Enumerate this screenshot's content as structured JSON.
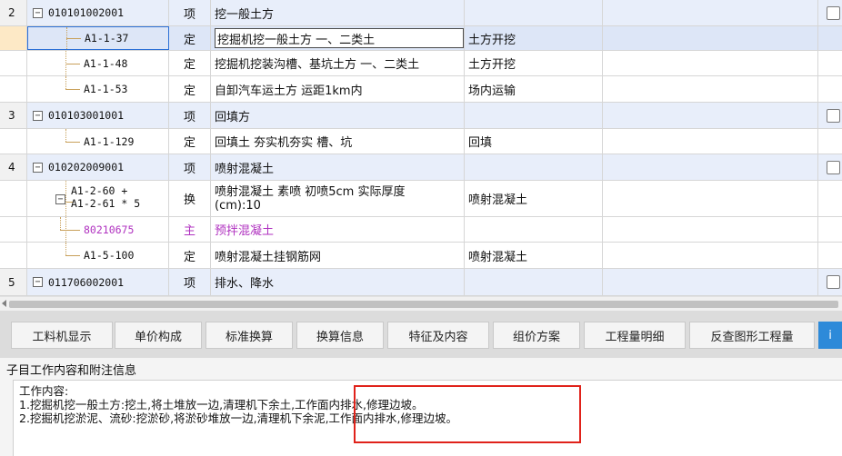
{
  "grid": {
    "rows": [
      {
        "kind": "item",
        "idx": "2",
        "code": "010101002001",
        "type": "项",
        "name": "挖一般土方",
        "spec": ""
      },
      {
        "kind": "sub",
        "idx": "",
        "code": "A1-1-37",
        "type": "定",
        "name": "挖掘机挖一般土方 一、二类土",
        "spec": "土方开挖",
        "selected": true
      },
      {
        "kind": "sub",
        "idx": "",
        "code": "A1-1-48",
        "type": "定",
        "name": "挖掘机挖装沟槽、基坑土方 一、二类土",
        "spec": "土方开挖"
      },
      {
        "kind": "sub",
        "idx": "",
        "code": "A1-1-53",
        "type": "定",
        "name": "自卸汽车运土方 运距1km内",
        "spec": "场内运输"
      },
      {
        "kind": "item",
        "idx": "3",
        "code": "010103001001",
        "type": "项",
        "name": "回填方",
        "spec": ""
      },
      {
        "kind": "sub",
        "idx": "",
        "code": "A1-1-129",
        "type": "定",
        "name": "回填土 夯实机夯实 槽、坑",
        "spec": "回填"
      },
      {
        "kind": "item",
        "idx": "4",
        "code": "010202009001",
        "type": "项",
        "name": "喷射混凝土",
        "spec": ""
      },
      {
        "kind": "sub2",
        "idx": "",
        "code_line1": "A1-2-60 +",
        "code_line2": "A1-2-61 * 5",
        "type": "换",
        "name_line1": "喷射混凝土 素喷 初喷5cm  实际厚度",
        "name_line2": "(cm):10",
        "spec": "喷射混凝土"
      },
      {
        "kind": "main",
        "idx": "",
        "code": "80210675",
        "type": "主",
        "name": "预拌混凝土",
        "spec": ""
      },
      {
        "kind": "sub",
        "idx": "",
        "code": "A1-5-100",
        "type": "定",
        "name": "喷射混凝土挂钢筋网",
        "spec": "喷射混凝土"
      },
      {
        "kind": "item",
        "idx": "5",
        "code": "011706002001",
        "type": "项",
        "name": "排水、降水",
        "spec": ""
      }
    ]
  },
  "tabs": [
    {
      "label": "工料机显示"
    },
    {
      "label": "单价构成"
    },
    {
      "label": "标准换算"
    },
    {
      "label": "换算信息"
    },
    {
      "label": "特征及内容"
    },
    {
      "label": "组价方案"
    },
    {
      "label": "工程量明细"
    },
    {
      "label": "反查图形工程量"
    },
    {
      "label": "i",
      "active": true
    }
  ],
  "info": {
    "title": "子目工作内容和附注信息",
    "heading": "工作内容:",
    "line1": "1.挖掘机挖一般土方:挖土,将土堆放一边,清理机下余土,工作面内排水,修理边坡。",
    "line2": "2.挖掘机挖淤泥、流砂:挖淤砂,将淤砂堆放一边,清理机下余泥,工作面内排水,修理边坡。"
  },
  "colors": {
    "selected_tab": "#2d8ad9",
    "highlight_box": "#e0221a",
    "item_row": "#e8eefa",
    "main_material_text": "#b032c0"
  }
}
